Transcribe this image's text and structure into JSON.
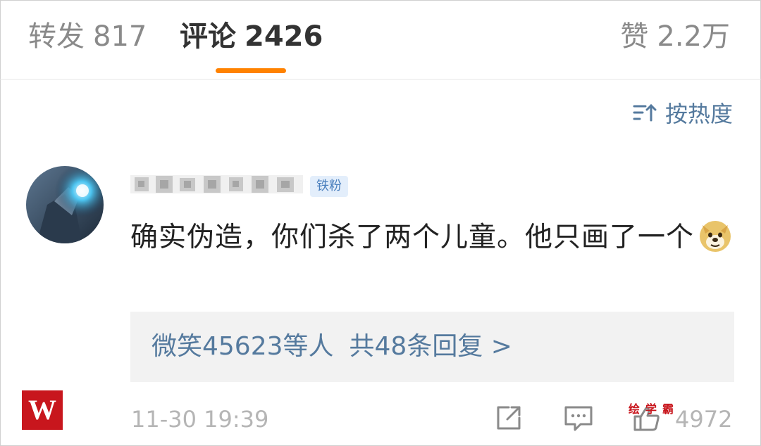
{
  "tabs": {
    "repost": {
      "label": "转发",
      "count": "817"
    },
    "comment": {
      "label": "评论",
      "count": "2426"
    },
    "like": {
      "label": "赞",
      "count": "2.2万"
    }
  },
  "sort": {
    "label": "按热度",
    "icon": "sort-icon"
  },
  "comment": {
    "badge": "铁粉",
    "text": "确实伪造，你们杀了两个儿童。他只画了一个",
    "emoji": "doge-emoji",
    "reply_summary": {
      "likers": "微笑45623等人",
      "replies": "共48条回复 >"
    },
    "time": "11-30 19:39",
    "like_count": "4972"
  },
  "overlay": {
    "logo_letter": "W",
    "watermark": "绘学霸"
  },
  "colors": {
    "accent": "#ff8200",
    "link": "#557a9e",
    "muted": "#8a8a8a",
    "logo": "#c8161d"
  }
}
